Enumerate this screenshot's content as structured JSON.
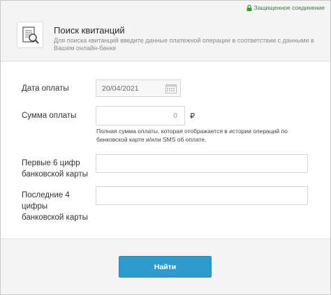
{
  "header": {
    "secure_label": "Защищенное соединение",
    "title": "Поиск квитанций",
    "subtitle": "Для поиска квитанций введите данные платежной операции в соответствии с данными в Вашем онлайн-банке"
  },
  "form": {
    "date": {
      "label": "Дата оплаты",
      "value": "20/04/2021"
    },
    "amount": {
      "label": "Сумма оплаты",
      "placeholder": "0",
      "currency": "₽",
      "hint": "Полная сумма оплаты, которая отображается в истории операций по банковской карте и/или SMS об оплате."
    },
    "first6": {
      "label": "Первые 6 цифр банковской карты",
      "value": ""
    },
    "last4": {
      "label": "Последние 4 цифры банковской карты",
      "value": ""
    }
  },
  "actions": {
    "submit_label": "Найти"
  },
  "colors": {
    "accent": "#2f9bcd",
    "secure": "#3a7a3a"
  },
  "icons": {
    "secure": "lock-icon",
    "logo": "receipt-search-icon",
    "calendar": "calendar-icon"
  }
}
